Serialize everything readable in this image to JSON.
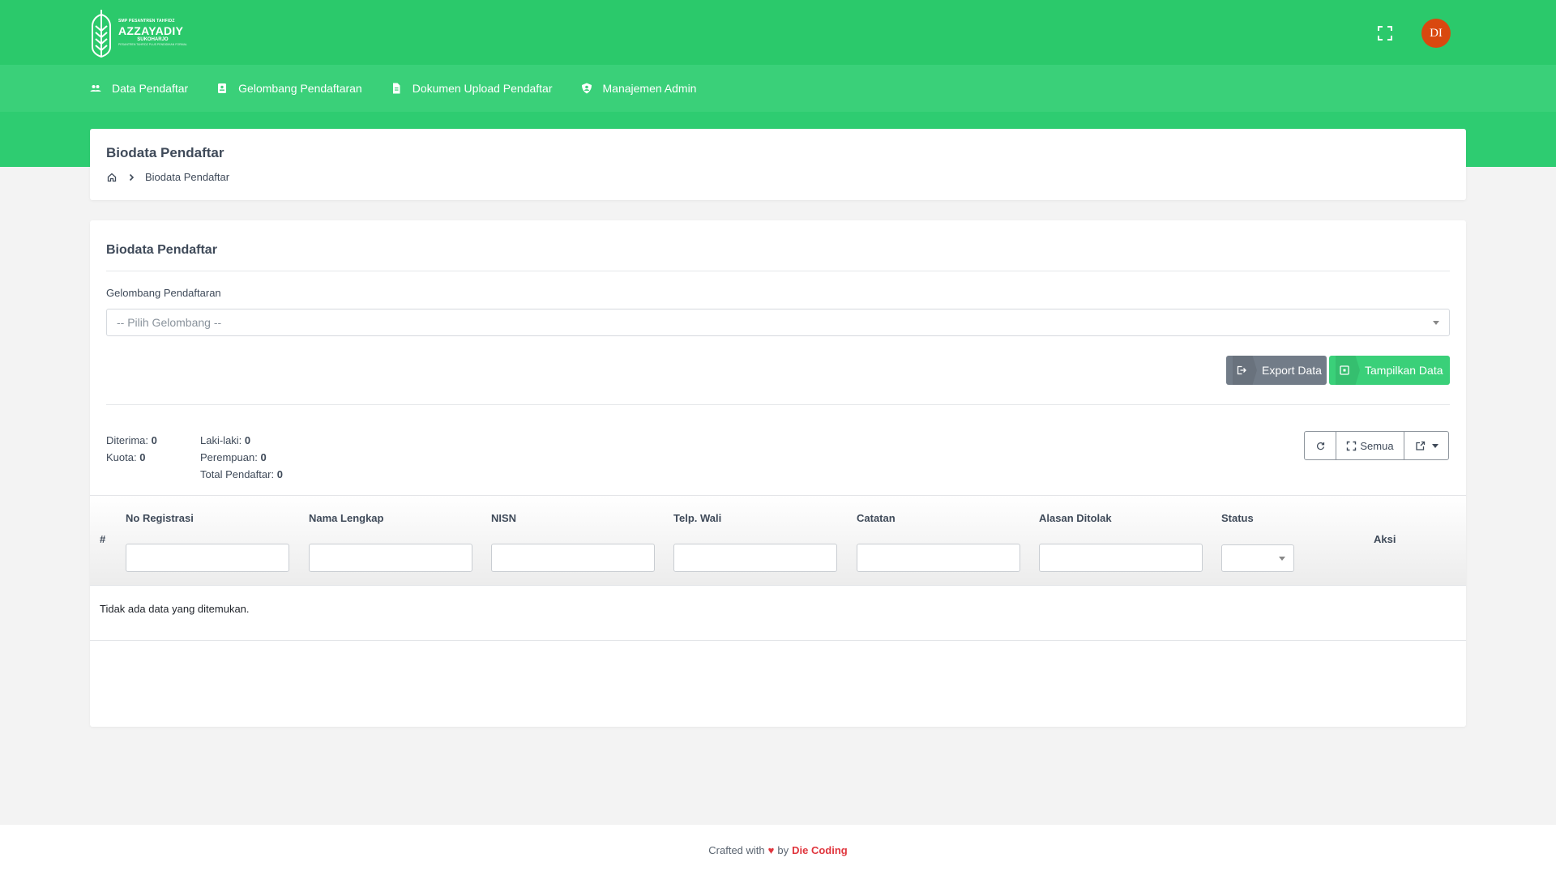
{
  "header": {
    "logo": {
      "small_text": "SMP PESANTREN TAHFIDZ",
      "name": "AZZAYADIY",
      "city": "SUKOHARJO",
      "tagline": "PESANTREN TAHFIDZ PLUS PENDIDIKAN FORMAL"
    },
    "avatar_initials": "DI"
  },
  "nav": {
    "items": [
      {
        "label": "Data Pendaftar",
        "icon": "users-icon"
      },
      {
        "label": "Gelombang Pendaftaran",
        "icon": "id-card-icon"
      },
      {
        "label": "Dokumen Upload Pendaftar",
        "icon": "file-icon"
      },
      {
        "label": "Manajemen Admin",
        "icon": "user-shield-icon"
      }
    ]
  },
  "page": {
    "title": "Biodata Pendaftar",
    "breadcrumb": [
      "Biodata Pendaftar"
    ]
  },
  "card": {
    "title": "Biodata Pendaftar",
    "filter_label": "Gelombang Pendaftaran",
    "filter_placeholder": "-- Pilih Gelombang --",
    "export_label": "Export Data",
    "show_label": "Tampilkan Data"
  },
  "stats": {
    "diterima_label": "Diterima:",
    "diterima": "0",
    "kuota_label": "Kuota:",
    "kuota": "0",
    "laki_label": "Laki-laki:",
    "laki": "0",
    "perempuan_label": "Perempuan:",
    "perempuan": "0",
    "total_label": "Total Pendaftar:",
    "total": "0"
  },
  "toolbar": {
    "all_label": "Semua"
  },
  "table": {
    "hash": "#",
    "columns": [
      "No Registrasi",
      "Nama Lengkap",
      "NISN",
      "Telp. Wali",
      "Catatan",
      "Alasan Ditolak",
      "Status"
    ],
    "actions": "Aksi",
    "empty_message": "Tidak ada data yang ditemukan."
  },
  "footer": {
    "prefix": "Crafted with",
    "by": "by",
    "brand": "Die Coding"
  },
  "colors": {
    "primary": "#2ecc71",
    "nav": "#3ad079",
    "avatar": "#d9480f",
    "secondary_button": "#727c88",
    "accent_red": "#e0353d"
  }
}
